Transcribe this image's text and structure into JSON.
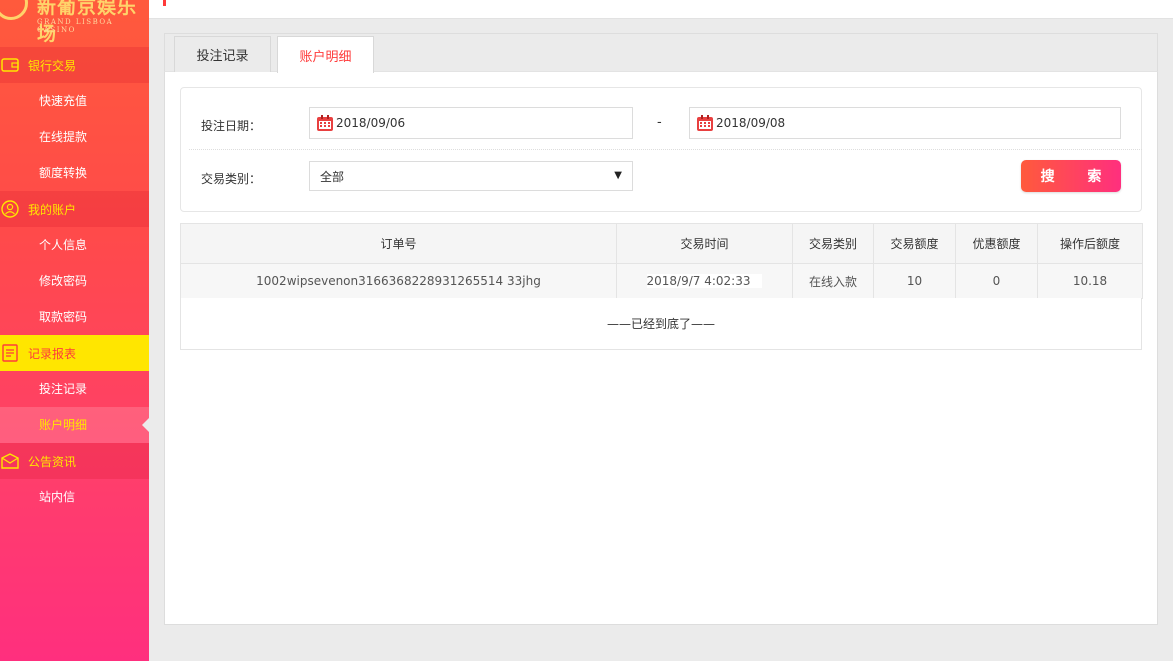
{
  "logo": {
    "title": "新葡京娱乐场",
    "subtitle": "GRAND LISBOA CASINO"
  },
  "sidebar": {
    "sections": [
      {
        "label": "银行交易",
        "icon": "wallet-icon",
        "items": [
          "快速充值",
          "在线提款",
          "额度转换"
        ]
      },
      {
        "label": "我的账户",
        "icon": "user-icon",
        "items": [
          "个人信息",
          "修改密码",
          "取款密码"
        ]
      },
      {
        "label": "记录报表",
        "icon": "report-icon",
        "items": [
          "投注记录",
          "账户明细"
        ]
      },
      {
        "label": "公告资讯",
        "icon": "mail-icon",
        "items": [
          "站内信"
        ]
      }
    ]
  },
  "tabs": {
    "bet_records": "投注记录",
    "account_details": "账户明细"
  },
  "filter": {
    "date_label": "投注日期：",
    "start_date": "2018/09/06",
    "dash": "-",
    "end_date": "2018/09/08",
    "type_label": "交易类别：",
    "type_value": "全部",
    "search_button": "搜  索"
  },
  "table": {
    "headers": [
      "订单号",
      "交易时间",
      "交易类别",
      "交易额度",
      "优惠额度",
      "操作后额度"
    ],
    "rows": [
      [
        "1002wipsevenon3166368228931265514 33jhg",
        "2018/9/7 4:02:33",
        "在线入款",
        "10",
        "0",
        "10.18"
      ]
    ],
    "end_text": "——已经到底了——"
  },
  "colors": {
    "accent": "#ff3a3a",
    "highlight": "#ffe600"
  }
}
